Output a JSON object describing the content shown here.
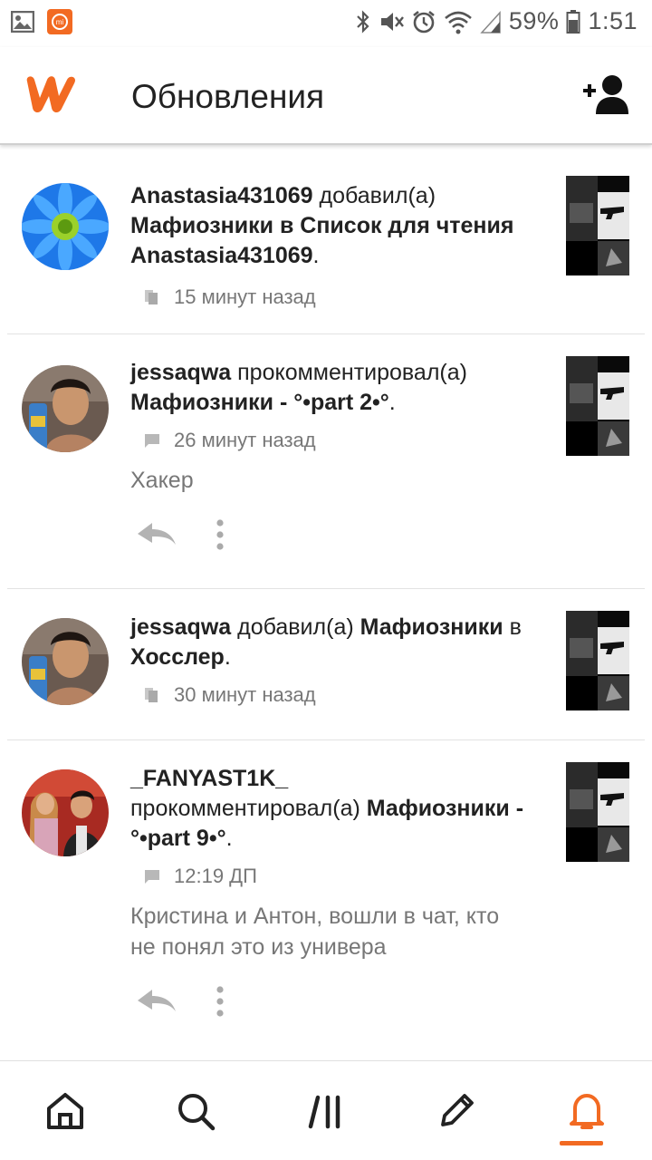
{
  "status_bar": {
    "battery": "59%",
    "time": "1:51"
  },
  "header": {
    "title": "Обновления"
  },
  "feed": [
    {
      "user": "Anastasia431069",
      "action": "добавил(а)",
      "story": "Мафиозники",
      "connector": "в",
      "target": "Список для чтения Anastasia431069",
      "end": ".",
      "meta_icon": "library-icon",
      "time": "15 минут назад"
    },
    {
      "user": "jessaqwa",
      "action": "прокомментировал(а)",
      "story": "Мафиозники - °•part 2•°",
      "end": ".",
      "meta_icon": "comment-icon",
      "time": "26 минут назад",
      "comment": "Хакер"
    },
    {
      "user": "jessaqwa",
      "action": "добавил(а)",
      "story": "Мафиозники",
      "connector": "в",
      "target": "Хосслер",
      "end": ".",
      "meta_icon": "library-icon",
      "time": "30 минут назад"
    },
    {
      "user": "_FANYAST1K_",
      "action": "прокомментировал(а)",
      "story": "Мафиозники - °•part 9•°",
      "end": ".",
      "meta_icon": "comment-icon",
      "time": "12:19 ДП",
      "comment": "Кристина и Антон, вошли в чат, кто не понял это из универа"
    }
  ],
  "colors": {
    "accent": "#f26a22",
    "text": "#222222",
    "muted": "#777777"
  }
}
